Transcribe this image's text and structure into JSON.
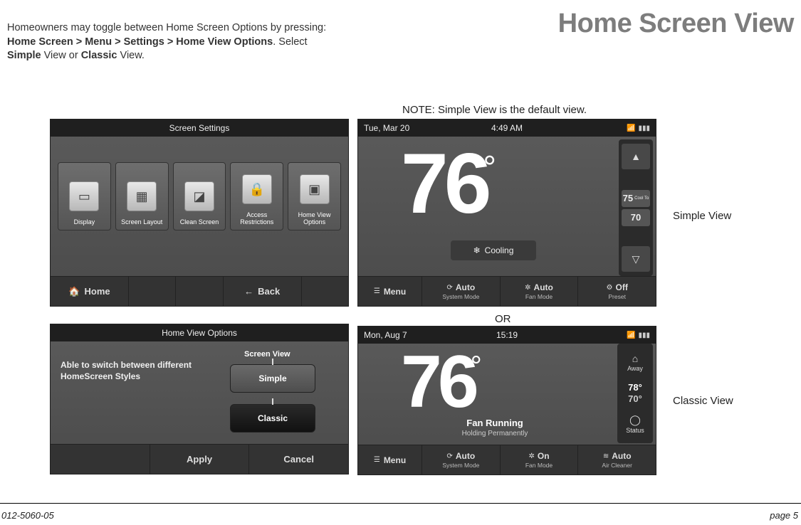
{
  "title": "Home Screen View",
  "intro": {
    "line1": "Homeowners may toggle between Home Screen Options by pressing:  ",
    "path": "Home Screen > Menu > Settings > Home View Options",
    "line2": ".  Select ",
    "opt1": "Simple",
    "mid": " View or ",
    "opt2": "Classic",
    "end": " View."
  },
  "note": "NOTE: Simple View is the default view.",
  "or": "OR",
  "label_simple": "Simple View",
  "label_classic": "Classic View",
  "doc_code": "012-5060-05",
  "page_num": "page 5",
  "settings": {
    "title": "Screen Settings",
    "tiles": [
      {
        "label": "Display"
      },
      {
        "label": "Screen Layout"
      },
      {
        "label": "Clean Screen"
      },
      {
        "label": "Access Restrictions"
      },
      {
        "label": "Home View Options"
      }
    ],
    "home": "Home",
    "back": "Back"
  },
  "hvo": {
    "title": "Home View Options",
    "desc": "Able to switch between different HomeScreen Styles",
    "section": "Screen View",
    "simple": "Simple",
    "classic": "Classic",
    "apply": "Apply",
    "cancel": "Cancel"
  },
  "simple": {
    "date": "Tue, Mar 20",
    "time": "4:49 AM",
    "temp": "76",
    "status": "Cooling",
    "cool_to_label": "Cool To",
    "cool_to": "75",
    "setpoint2": "70",
    "menu": "Menu",
    "sys_mode_big": "Auto",
    "sys_mode_small": "System Mode",
    "fan_mode_big": "Auto",
    "fan_mode_small": "Fan Mode",
    "preset_big": "Off",
    "preset_small": "Preset"
  },
  "classic": {
    "date": "Mon, Aug 7",
    "time": "15:19",
    "temp": "76",
    "fan1": "Fan Running",
    "fan2": "Holding Permanently",
    "menu": "Menu",
    "sys_mode_big": "Auto",
    "sys_mode_small": "System Mode",
    "fan_mode_big": "On",
    "fan_mode_small": "Fan Mode",
    "air_big": "Auto",
    "air_small": "Air Cleaner",
    "away": "Away",
    "sp_cool": "78°",
    "sp_heat": "70°",
    "status": "Status"
  }
}
